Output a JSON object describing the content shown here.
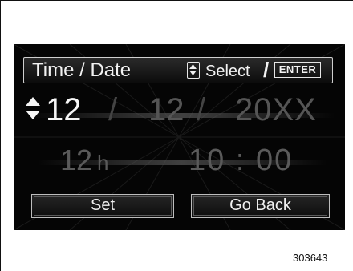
{
  "header": {
    "title": "Time / Date",
    "updown_icon": "up-down-arrows-icon",
    "select_label": "Select",
    "separator": "/",
    "enter_label": "ENTER"
  },
  "date": {
    "selector_icon": "up-down-arrows-icon",
    "month": "12",
    "sep1": "/",
    "day": "12",
    "sep2": "/",
    "year": "20XX"
  },
  "time": {
    "hour_mode": "12",
    "hour_mode_unit": "h",
    "clock": "10 : 00"
  },
  "buttons": {
    "set_label": "Set",
    "back_label": "Go Back"
  },
  "figure_code": "303643"
}
